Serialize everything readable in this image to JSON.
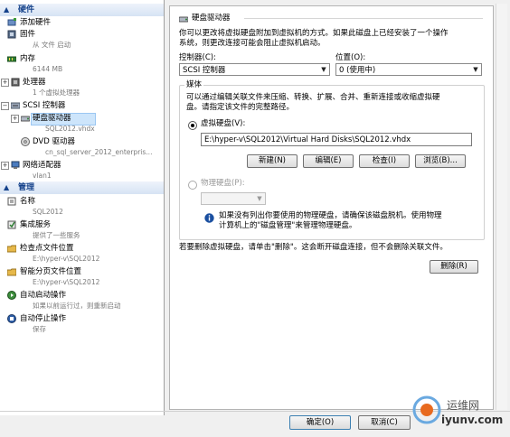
{
  "left": {
    "hardware_header": "硬件",
    "add_hardware": "添加硬件",
    "firmware": "固件",
    "firmware_sub": "从 文件 启动",
    "memory": "内存",
    "memory_sub": "6144 MB",
    "processor": "处理器",
    "processor_sub": "1 个虚拟处理器",
    "scsi": "SCSI 控制器",
    "hdd": "硬盘驱动器",
    "hdd_sub": "SQL2012.vhdx",
    "dvd": "DVD 驱动器",
    "dvd_sub": "cn_sql_server_2012_enterpris...",
    "nic": "网络适配器",
    "nic_sub": "vlan1",
    "manage_header": "管理",
    "name": "名称",
    "name_sub": "SQL2012",
    "integration": "集成服务",
    "integration_sub": "提供了一些服务",
    "checkpoint": "检查点文件位置",
    "checkpoint_sub": "E:\\hyper-v\\SQL2012",
    "paging": "智能分页文件位置",
    "paging_sub": "E:\\hyper-v\\SQL2012",
    "autostart": "自动启动操作",
    "autostart_sub": "如果以前运行过，则重新启动",
    "autostop": "自动停止操作",
    "autostop_sub": "保存"
  },
  "right": {
    "title": "硬盘驱动器",
    "desc1": "你可以更改将虚拟硬盘附加到虚拟机的方式。如果此磁盘上已经安装了一个操作",
    "desc2": "系统，则更改连接可能会阻止虚拟机启动。",
    "controller_label": "控制器(C):",
    "controller_value": "SCSI 控制器",
    "location_label": "位置(O):",
    "location_value": "0 (使用中)",
    "media_label": "媒体",
    "media_desc1": "可以通过编辑关联文件来压缩、转换、扩展、合并、重新连接或收缩虚拟硬",
    "media_desc2": "盘。请指定该文件的完整路径。",
    "vhd_label": "虚拟硬盘(V):",
    "vhd_path": "E:\\hyper-v\\SQL2012\\Virtual Hard Disks\\SQL2012.vhdx",
    "new_btn": "新建(N)",
    "edit_btn": "编辑(E)",
    "inspect_btn": "检查(I)",
    "browse_btn": "浏览(B)...",
    "physical_label": "物理硬盘(P):",
    "info1": "如果没有列出你要使用的物理硬盘，请确保该磁盘脱机。使用物理",
    "info2": "计算机上的\"磁盘管理\"来管理物理硬盘。",
    "remove_desc": "若要删除虚拟硬盘，请单击\"删除\"。这会断开磁盘连接，但不会删除关联文件。",
    "remove_btn": "删除(R)"
  },
  "footer": {
    "ok_btn": "确定(O)",
    "cancel_btn": "取消(C)",
    "watermark_cn": "运维网",
    "watermark_url": "iyunv.com"
  },
  "colors": {
    "header_text": "#15428b",
    "selection": "#cde5fb",
    "info_icon": "#1a4fa0"
  }
}
